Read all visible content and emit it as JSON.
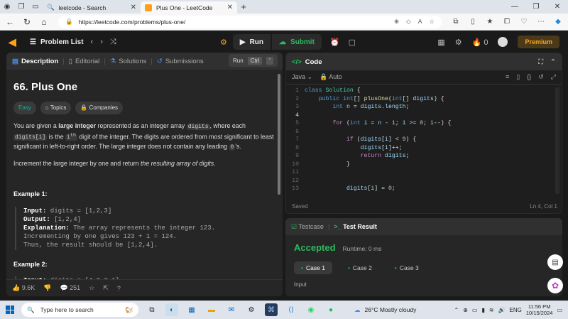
{
  "browser": {
    "tabs": [
      {
        "label": "leetcode - Search",
        "active": false
      },
      {
        "label": "Plus One - LeetCode",
        "active": true
      }
    ],
    "url": "https://leetcode.com/problems/plus-one/"
  },
  "lc_top": {
    "problem_list": "Problem List",
    "run": "Run",
    "submit": "Submit",
    "streak": "0",
    "premium": "Premium"
  },
  "tooltip": {
    "label": "Run",
    "key": "Ctrl",
    "key2": "'"
  },
  "left_tabs": [
    "Description",
    "Editorial",
    "Solutions",
    "Submissions"
  ],
  "problem": {
    "title": "66. Plus One",
    "difficulty": "Easy",
    "tags": [
      "Topics",
      "Companies"
    ],
    "p1_a": "You are given a ",
    "p1_b": "large integer",
    "p1_c": " represented as an integer array ",
    "p1_code1": "digits",
    "p1_d": ", where each ",
    "p1_code2": "digits[i]",
    "p1_e": " is the ",
    "p1_f": "i",
    "p1_g": "th",
    "p1_h": " digit of the integer. The digits are ordered from most significant to least significant in left-to-right order. The large integer does not contain any leading ",
    "p1_code3": "0",
    "p1_i": "'s.",
    "p2_a": "Increment the large integer by one and return ",
    "p2_b": "the resulting array of digits",
    "p2_c": ".",
    "example1": {
      "title": "Example 1:",
      "input_label": "Input:",
      "input": " digits = [1,2,3]",
      "output_label": "Output:",
      "output": " [1,2,4]",
      "expl_label": "Explanation:",
      "expl1": " The array represents the integer 123.",
      "expl2": "Incrementing by one gives 123 + 1 = 124.",
      "expl3": "Thus, the result should be [1,2,4]."
    },
    "example2": {
      "title": "Example 2:",
      "input_label": "Input:",
      "input": " digits = [4,3,2,1]"
    }
  },
  "left_bottom": {
    "likes": "9.6K",
    "comments": "251"
  },
  "code": {
    "header": "Code",
    "language": "Java",
    "mode": "Auto",
    "saved": "Saved",
    "cursor": "Ln 4, Col 1"
  },
  "test": {
    "tab1": "Testcase",
    "tab2": "Test Result",
    "status": "Accepted",
    "runtime": "Runtime: 0 ms",
    "cases": [
      "Case 1",
      "Case 2",
      "Case 3"
    ],
    "input_label": "Input"
  },
  "taskbar": {
    "search_placeholder": "Type here to search",
    "weather": "26°C  Mostly cloudy",
    "lang": "ENG",
    "time": "11:56 PM",
    "date": "10/15/2024"
  }
}
